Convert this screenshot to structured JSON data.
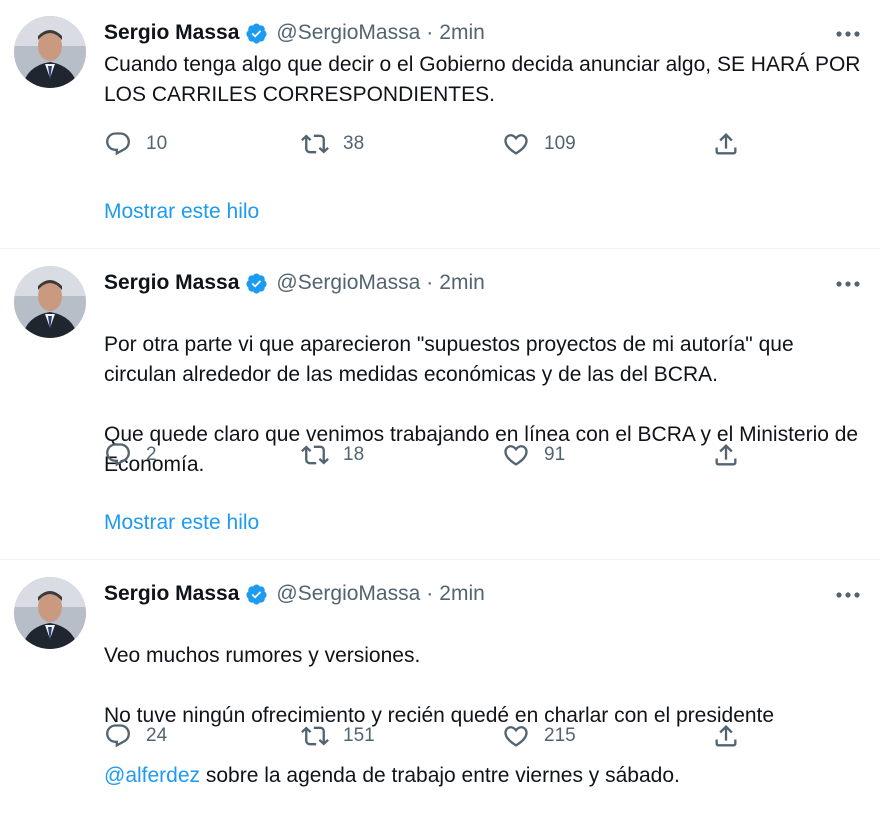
{
  "tweets": [
    {
      "author": "Sergio Massa",
      "handle": "@SergioMassa",
      "separator": "·",
      "time": "2min",
      "text": "Cuando tenga algo que decir o el Gobierno decida anunciar algo, SE HARÁ POR LOS CARRILES CORRESPONDIENTES.",
      "replies": "10",
      "retweets": "38",
      "likes": "109",
      "thread_link": "Mostrar este hilo"
    },
    {
      "author": "Sergio Massa",
      "handle": "@SergioMassa",
      "separator": "·",
      "time": "2min",
      "text_lines": [
        "Por otra parte vi que aparecieron \"supuestos proyectos de mi autoría\" que circulan alrededor de las medidas económicas y de las del BCRA.",
        "Que quede claro que venimos trabajando en línea con el BCRA y el Ministerio de Economía."
      ],
      "replies": "2",
      "retweets": "18",
      "likes": "91",
      "thread_link": "Mostrar este hilo"
    },
    {
      "author": "Sergio Massa",
      "handle": "@SergioMassa",
      "separator": "·",
      "time": "2min",
      "text_line1": "Veo muchos rumores y versiones.",
      "text_line2": "No tuve ningún ofrecimiento y recién quedé en charlar con el presidente",
      "mention": "@alferdez",
      "text_line3_rest": " sobre la agenda de trabajo entre viernes y sábado.",
      "replies": "24",
      "retweets": "151",
      "likes": "215"
    }
  ],
  "icons": {
    "reply": "reply-icon",
    "retweet": "retweet-icon",
    "like": "like-icon",
    "share": "share-icon",
    "more": "more-options-icon",
    "verified": "verified-badge-icon"
  },
  "colors": {
    "accent": "#1d9bf0",
    "secondary_text": "#536471",
    "primary_text": "#0f1419",
    "divider": "#eff3f4"
  }
}
